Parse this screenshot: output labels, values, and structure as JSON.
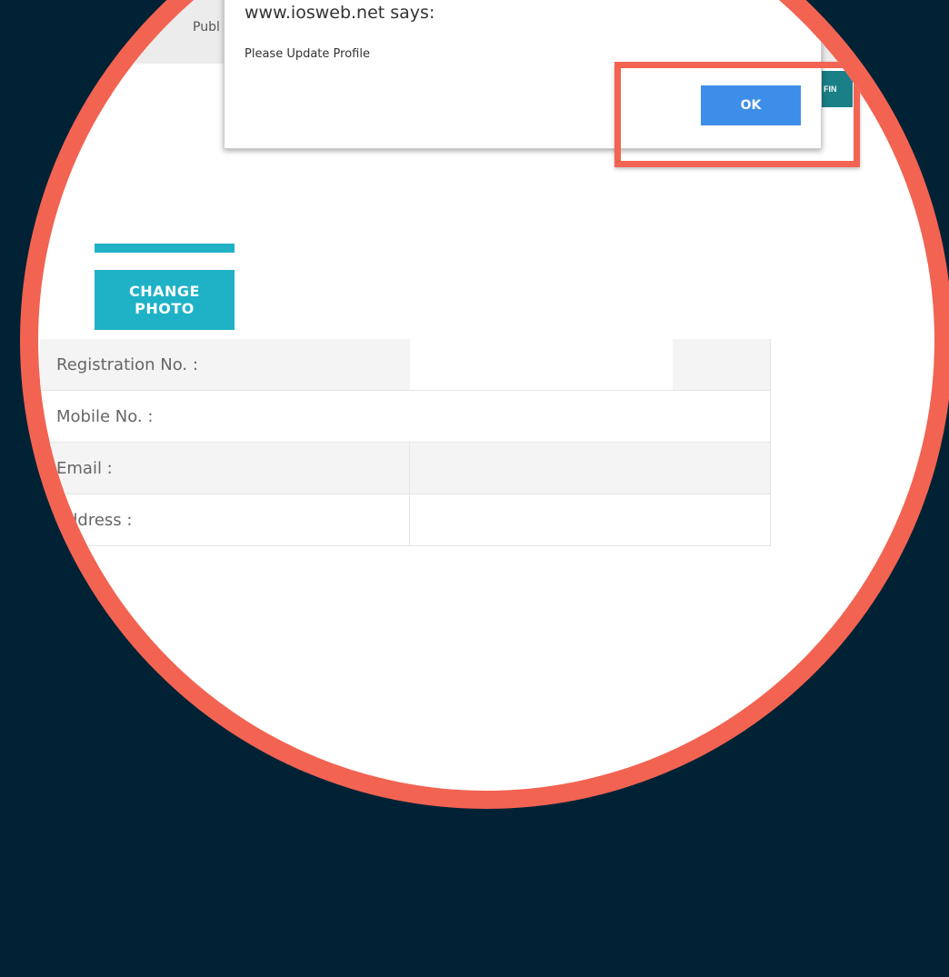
{
  "header": {
    "partial_text": "Publ"
  },
  "teal_tab": {
    "label": "FIN"
  },
  "dialog": {
    "title": "www.iosweb.net says:",
    "message": "Please Update Profile",
    "ok_label": "OK"
  },
  "profile": {
    "change_photo_label": "CHANGE PHOTO",
    "fields": [
      {
        "label": "Registration No. :",
        "value": ""
      },
      {
        "label": "Mobile No. :",
        "value": ""
      },
      {
        "label": "Email :",
        "value": ""
      },
      {
        "label": "Address :",
        "value": ""
      }
    ]
  },
  "colors": {
    "background": "#012235",
    "highlight": "#F26352",
    "accent": "#1fb2c7",
    "ok_button": "#3d8ee8"
  }
}
